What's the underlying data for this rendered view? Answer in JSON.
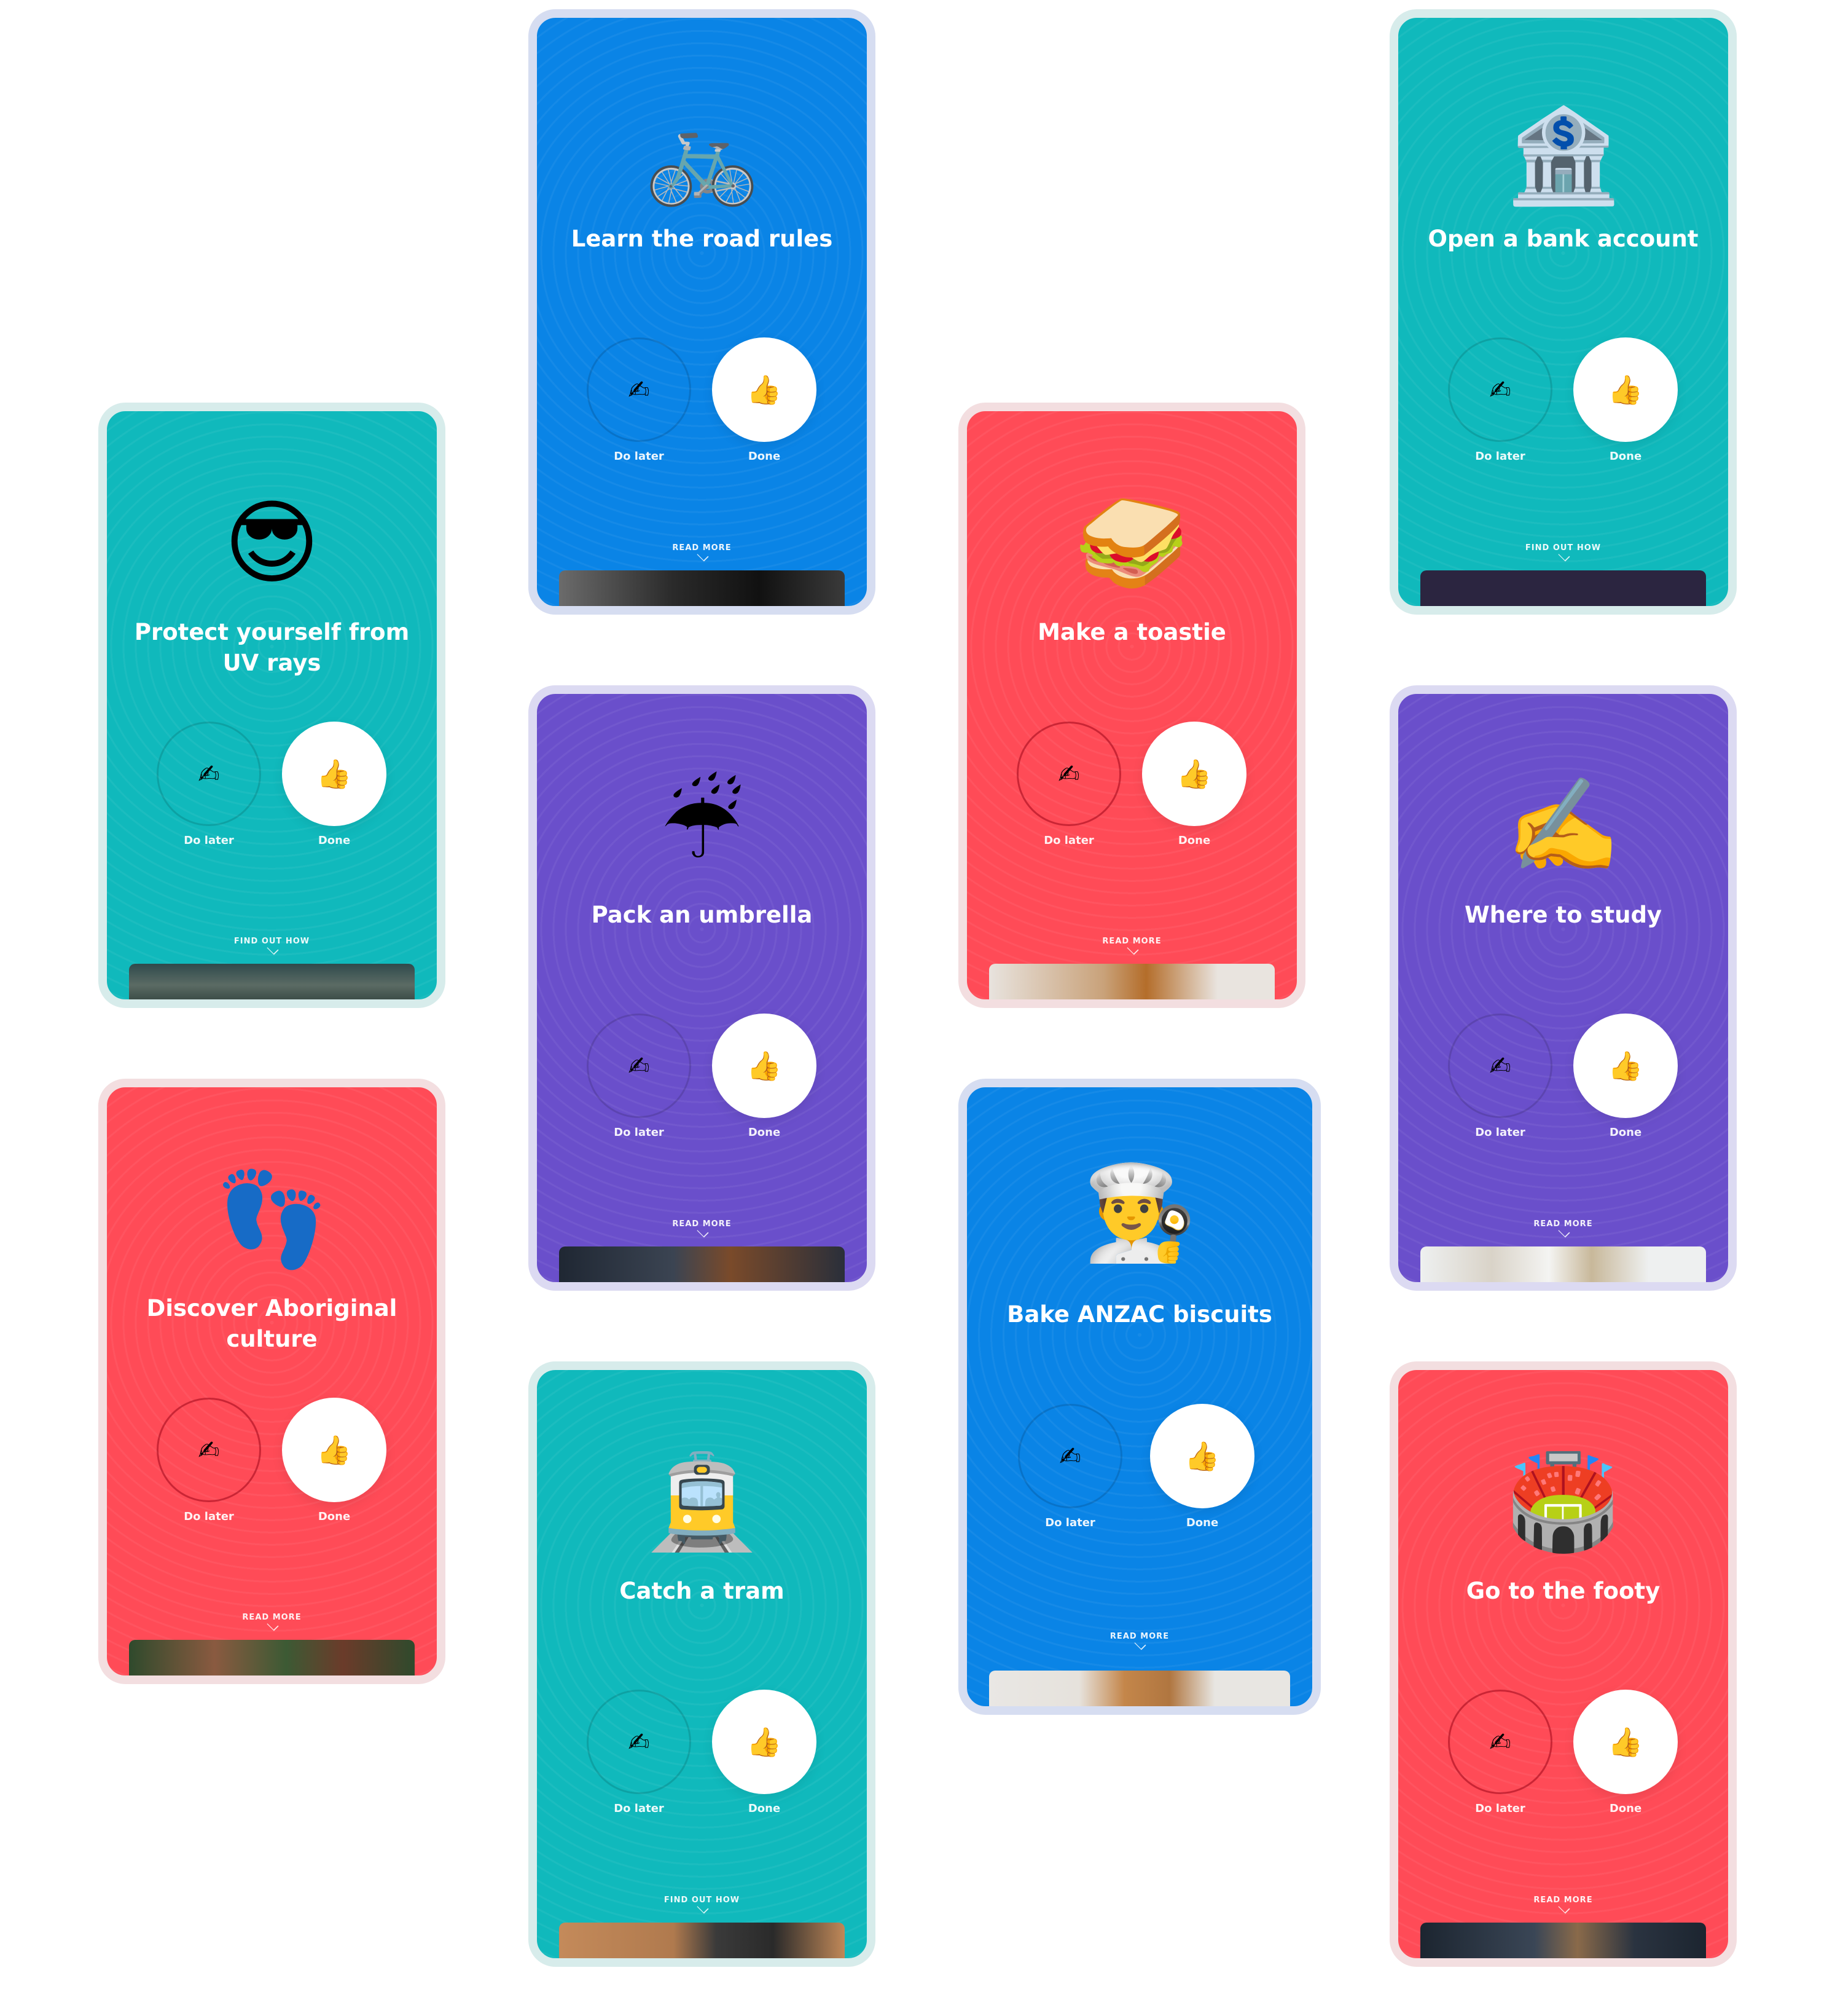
{
  "common": {
    "later_label": "Do later",
    "done_label": "Done",
    "later_icon": "✍",
    "done_icon": "👍"
  },
  "cards": {
    "uv": {
      "emoji": "😎",
      "title": "Protect yourself from UV rays",
      "link": "FIND OUT HOW",
      "theme": "teal"
    },
    "road": {
      "emoji": "🚲",
      "title": "Learn the road rules",
      "link": "READ MORE",
      "theme": "blue"
    },
    "bank": {
      "emoji": "🏦",
      "title": "Open a bank account",
      "link": "FIND OUT HOW",
      "theme": "teal"
    },
    "toastie": {
      "emoji": "🥪",
      "title": "Make a toastie",
      "link": "READ MORE",
      "theme": "red"
    },
    "umbrella": {
      "emoji": "☔",
      "title": "Pack an umbrella",
      "link": "READ MORE",
      "theme": "purple"
    },
    "study": {
      "emoji": "✍️",
      "title": "Where to study",
      "link": "READ MORE",
      "theme": "purple"
    },
    "aboriginal": {
      "emoji": "👣",
      "title": "Discover Aboriginal culture",
      "link": "READ MORE",
      "theme": "red"
    },
    "anzac": {
      "emoji": "👨‍🍳",
      "title": "Bake ANZAC biscuits",
      "link": "READ MORE",
      "theme": "blue"
    },
    "tram": {
      "emoji": "🚊",
      "title": "Catch a tram",
      "link": "FIND OUT HOW",
      "theme": "teal"
    },
    "footy": {
      "emoji": "🏟️",
      "title": "Go to the footy",
      "link": "READ MORE",
      "theme": "red"
    }
  },
  "colors": {
    "teal": "#10B9BC",
    "blue": "#0A84E6",
    "red": "#FF4B57",
    "purple": "#6A4FCB"
  }
}
